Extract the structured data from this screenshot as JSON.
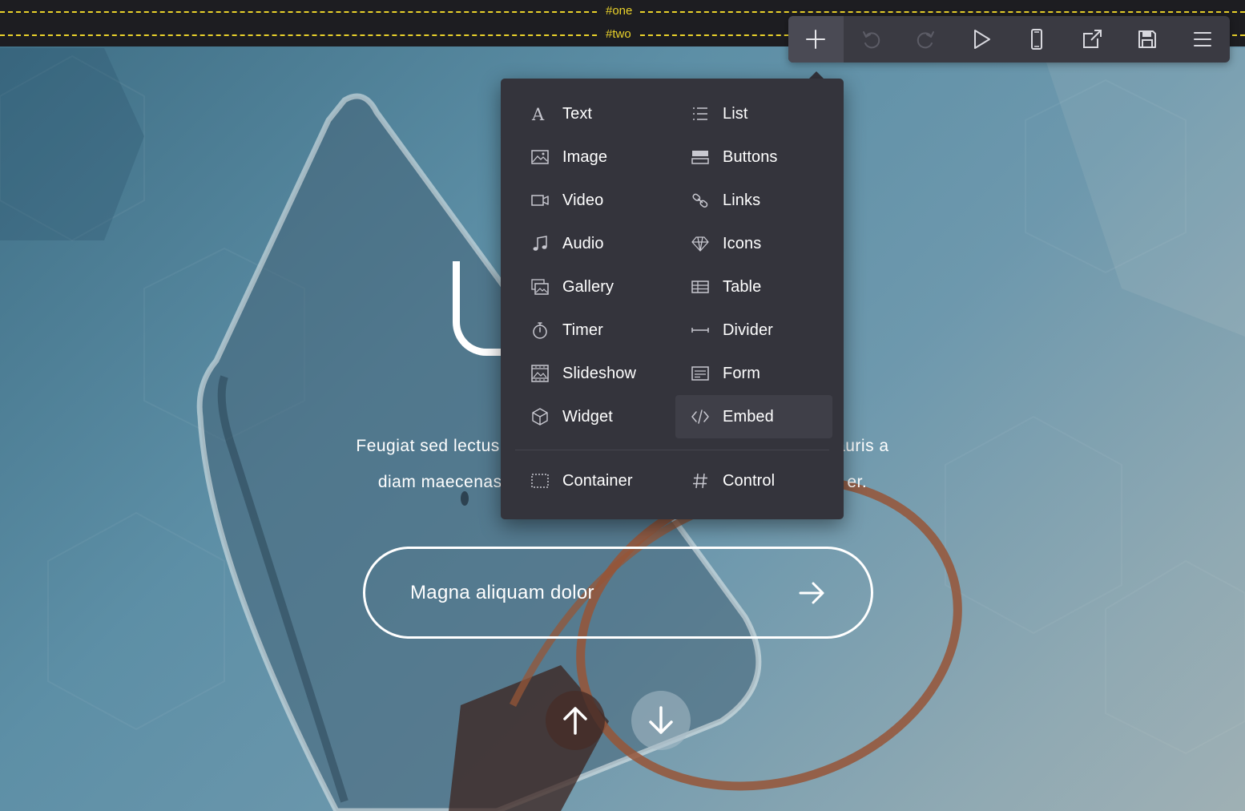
{
  "section_markers": [
    {
      "label": "#one"
    },
    {
      "label": "#two"
    }
  ],
  "colors": {
    "marker": "#e9d12a",
    "toolbar_bg": "#3a3a42",
    "menu_bg": "#34343c",
    "menu_text": "#ffffff",
    "icon_color": "#c8c8d0"
  },
  "toolbar": {
    "buttons": [
      {
        "name": "add-button",
        "icon": "plus-icon",
        "active": true
      },
      {
        "name": "undo-button",
        "icon": "undo-icon",
        "disabled": true
      },
      {
        "name": "redo-button",
        "icon": "redo-icon",
        "disabled": true
      },
      {
        "name": "preview-button",
        "icon": "play-icon"
      },
      {
        "name": "mobile-view-button",
        "icon": "phone-icon"
      },
      {
        "name": "open-external-button",
        "icon": "external-link-icon"
      },
      {
        "name": "save-button",
        "icon": "floppy-disk-icon"
      },
      {
        "name": "menu-button",
        "icon": "hamburger-icon"
      }
    ]
  },
  "add_menu": {
    "items": [
      {
        "label": "Text",
        "icon": "text-icon"
      },
      {
        "label": "List",
        "icon": "list-icon"
      },
      {
        "label": "Image",
        "icon": "image-icon"
      },
      {
        "label": "Buttons",
        "icon": "buttons-icon"
      },
      {
        "label": "Video",
        "icon": "video-icon"
      },
      {
        "label": "Links",
        "icon": "links-icon"
      },
      {
        "label": "Audio",
        "icon": "music-note-icon"
      },
      {
        "label": "Icons",
        "icon": "diamond-icon"
      },
      {
        "label": "Gallery",
        "icon": "gallery-icon"
      },
      {
        "label": "Table",
        "icon": "table-icon"
      },
      {
        "label": "Timer",
        "icon": "stopwatch-icon"
      },
      {
        "label": "Divider",
        "icon": "divider-icon"
      },
      {
        "label": "Slideshow",
        "icon": "slideshow-icon"
      },
      {
        "label": "Form",
        "icon": "form-icon"
      },
      {
        "label": "Widget",
        "icon": "cube-icon"
      },
      {
        "label": "Embed",
        "icon": "code-icon",
        "highlighted": true
      }
    ],
    "footer_items": [
      {
        "label": "Container",
        "icon": "container-icon"
      },
      {
        "label": "Control",
        "icon": "hash-icon"
      }
    ]
  },
  "hero": {
    "description_line1": "Feugiat sed lectus vestibu                                             lias mauris a",
    "description_line2": "diam maecenas                                                                    er.",
    "cta_label": "Magna aliquam dolor",
    "cta_icon": "arrow-right-icon",
    "nav_up_icon": "arrow-up-icon",
    "nav_down_icon": "arrow-down-icon"
  }
}
